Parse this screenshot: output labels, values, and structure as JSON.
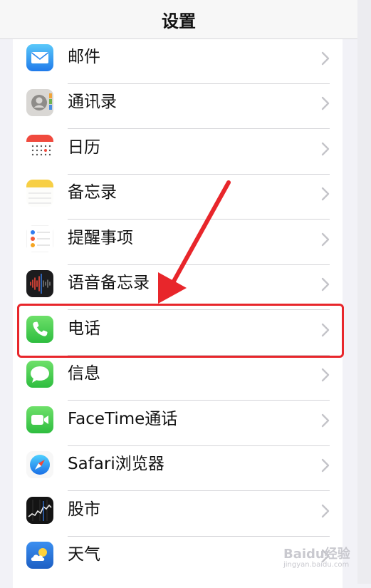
{
  "header": {
    "title": "设置"
  },
  "rows": [
    {
      "label": "邮件",
      "icon": "mail-icon"
    },
    {
      "label": "通讯录",
      "icon": "contacts-icon"
    },
    {
      "label": "日历",
      "icon": "calendar-icon"
    },
    {
      "label": "备忘录",
      "icon": "notes-icon"
    },
    {
      "label": "提醒事项",
      "icon": "reminders-icon"
    },
    {
      "label": "语音备忘录",
      "icon": "voice-memos-icon"
    },
    {
      "label": "电话",
      "icon": "phone-icon"
    },
    {
      "label": "信息",
      "icon": "messages-icon"
    },
    {
      "label": "FaceTime通话",
      "icon": "facetime-icon"
    },
    {
      "label": "Safari浏览器",
      "icon": "safari-icon"
    },
    {
      "label": "股市",
      "icon": "stocks-icon"
    },
    {
      "label": "天气",
      "icon": "weather-icon"
    }
  ],
  "annotation": {
    "highlight_color": "#e8262b",
    "highlighted_row": "电话"
  },
  "watermark": {
    "brand": "Baidu经验",
    "url": "jingyan.baidu.com"
  }
}
